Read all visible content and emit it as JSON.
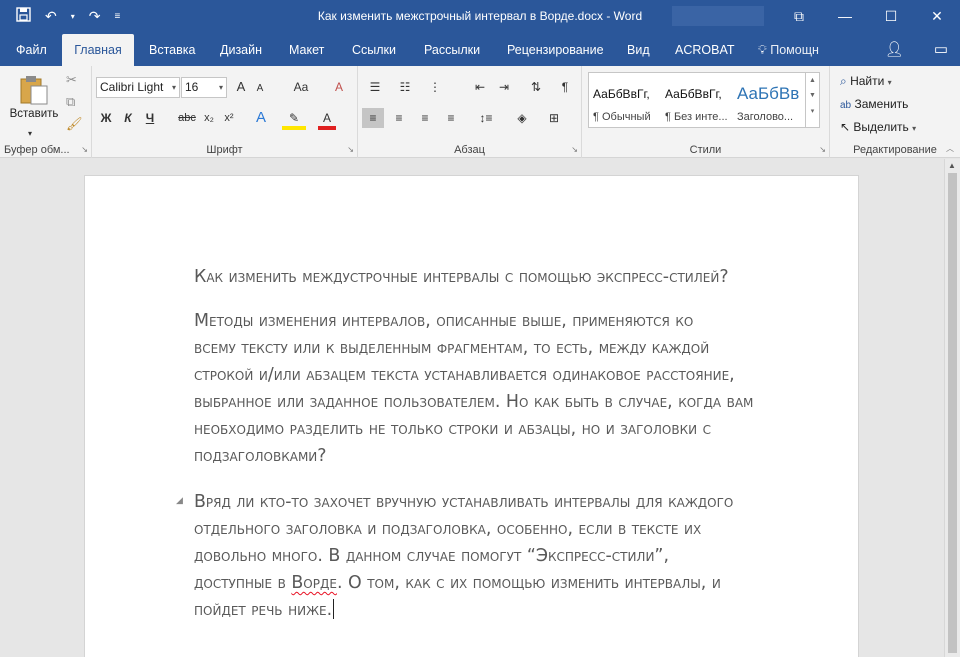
{
  "window": {
    "title": "Как изменить межстрочный интервал в Ворде.docx - Word",
    "controls": [
      "⧉",
      "—",
      "☐",
      "✕"
    ]
  },
  "tabs": [
    {
      "label": "Файл"
    },
    {
      "label": "Главная"
    },
    {
      "label": "Вставка"
    },
    {
      "label": "Дизайн"
    },
    {
      "label": "Макет"
    },
    {
      "label": "Ссылки"
    },
    {
      "label": "Рассылки"
    },
    {
      "label": "Рецензирование"
    },
    {
      "label": "Вид"
    },
    {
      "label": "ACROBAT"
    },
    {
      "label": "Помощн"
    }
  ],
  "ribbon": {
    "clipboard": {
      "paste_label": "Вставить",
      "group_label": "Буфер обм..."
    },
    "font": {
      "font_name": "Calibri Light",
      "font_size": "16",
      "group_label": "Шрифт",
      "bold": "Ж",
      "italic": "К",
      "underline": "Ч",
      "strike": "abc",
      "sub": "x₂",
      "sup": "x²",
      "grow": "A",
      "shrink": "A",
      "case": "Aa"
    },
    "paragraph": {
      "group_label": "Абзац"
    },
    "styles": {
      "group_label": "Стили",
      "items": [
        {
          "sample": "АаБбВвГг,",
          "name": "¶ Обычный"
        },
        {
          "sample": "АаБбВвГг,",
          "name": "¶ Без инте..."
        },
        {
          "sample": "АаБбВв",
          "name": "Заголово..."
        }
      ]
    },
    "editing": {
      "group_label": "Редактирование",
      "find": "Найти",
      "replace": "Заменить",
      "select": "Выделить"
    }
  },
  "document": {
    "heading": "Как изменить междустрочные интервалы с помощью экспресс-стилей?",
    "para1": [
      "Методы изменения интервалов, описанные выше, применяются ко",
      "всему тексту или к выделенным фрагментам, то есть, между каждой",
      "строкой и/или абзацем текста устанавливается одинаковое расстояние,",
      "выбранное или заданное пользователем. Но как быть в случае, когда вам",
      "необходимо разделить не только строки и абзацы, но и заголовки с",
      "подзаголовками?"
    ],
    "para2": [
      "Вряд ли кто-то захочет вручную устанавливать интервалы для каждого",
      "отдельного заголовка и подзаголовка, особенно, если в тексте их",
      "довольно много. В данном случае помогут “Экспресс-стили”,"
    ],
    "para2_line4_a": "доступные в ",
    "para2_line4_word": "Ворде",
    "para2_line4_b": ". О том, как с их помощью изменить интервалы, и",
    "para2_line5": "пойдет речь ниже."
  }
}
